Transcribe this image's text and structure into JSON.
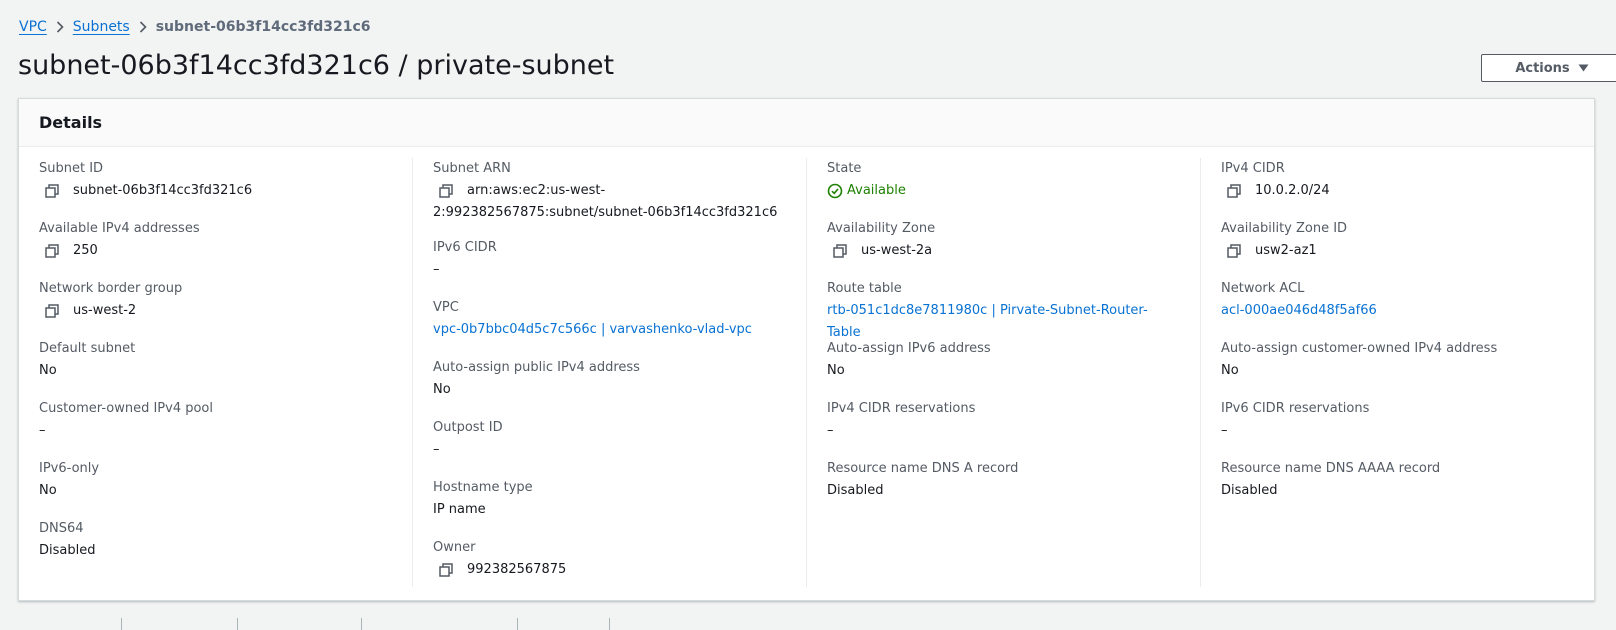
{
  "breadcrumb": {
    "items": [
      "VPC",
      "Subnets"
    ],
    "current": "subnet-06b3f14cc3fd321c6"
  },
  "page": {
    "title": "subnet-06b3f14cc3fd321c6 / private-subnet",
    "actions_label": "Actions"
  },
  "details": {
    "title": "Details",
    "col1": {
      "subnet_id": {
        "label": "Subnet ID",
        "value": "subnet-06b3f14cc3fd321c6"
      },
      "available_ipv4": {
        "label": "Available IPv4 addresses",
        "value": "250"
      },
      "network_border_group": {
        "label": "Network border group",
        "value": "us-west-2"
      },
      "default_subnet": {
        "label": "Default subnet",
        "value": "No"
      },
      "customer_owned_pool": {
        "label": "Customer-owned IPv4 pool",
        "value": "–"
      },
      "ipv6_only": {
        "label": "IPv6-only",
        "value": "No"
      },
      "dns64": {
        "label": "DNS64",
        "value": "Disabled"
      }
    },
    "col2": {
      "subnet_arn": {
        "label": "Subnet ARN",
        "value_line1": "arn:aws:ec2:us-west-",
        "value_line2": "2:992382567875:subnet/subnet-06b3f14cc3fd321c6"
      },
      "ipv6_cidr": {
        "label": "IPv6 CIDR",
        "value": "–"
      },
      "vpc": {
        "label": "VPC",
        "value": "vpc-0b7bbc04d5c7c566c | varvashenko-vlad-vpc"
      },
      "auto_assign_public_ipv4": {
        "label": "Auto-assign public IPv4 address",
        "value": "No"
      },
      "outpost_id": {
        "label": "Outpost ID",
        "value": "–"
      },
      "hostname_type": {
        "label": "Hostname type",
        "value": "IP name"
      },
      "owner": {
        "label": "Owner",
        "value": "992382567875"
      }
    },
    "col3": {
      "state": {
        "label": "State",
        "value": "Available"
      },
      "availability_zone": {
        "label": "Availability Zone",
        "value": "us-west-2a"
      },
      "route_table": {
        "label": "Route table",
        "value": "rtb-051c1dc8e7811980c | Pirvate-Subnet-Router-Table"
      },
      "auto_assign_ipv6": {
        "label": "Auto-assign IPv6 address",
        "value": "No"
      },
      "ipv4_cidr_reservations": {
        "label": "IPv4 CIDR reservations",
        "value": "–"
      },
      "dns_a_record": {
        "label": "Resource name DNS A record",
        "value": "Disabled"
      }
    },
    "col4": {
      "ipv4_cidr": {
        "label": "IPv4 CIDR",
        "value": "10.0.2.0/24"
      },
      "availability_zone_id": {
        "label": "Availability Zone ID",
        "value": "usw2-az1"
      },
      "network_acl": {
        "label": "Network ACL",
        "value": "acl-000ae046d48f5af66"
      },
      "auto_assign_customer_owned": {
        "label": "Auto-assign customer-owned IPv4 address",
        "value": "No"
      },
      "ipv6_cidr_reservations": {
        "label": "IPv6 CIDR reservations",
        "value": "–"
      },
      "dns_aaaa_record": {
        "label": "Resource name DNS AAAA record",
        "value": "Disabled"
      }
    }
  },
  "colors": {
    "link": "#0972d3",
    "success": "#1d8102",
    "text": "#16191f",
    "label": "#545b64"
  },
  "icons": {
    "copy": "copy-icon",
    "status": "status-positive-icon",
    "caret": "caret-down-icon",
    "breadcrumb_sep": "chevron-right-icon"
  }
}
